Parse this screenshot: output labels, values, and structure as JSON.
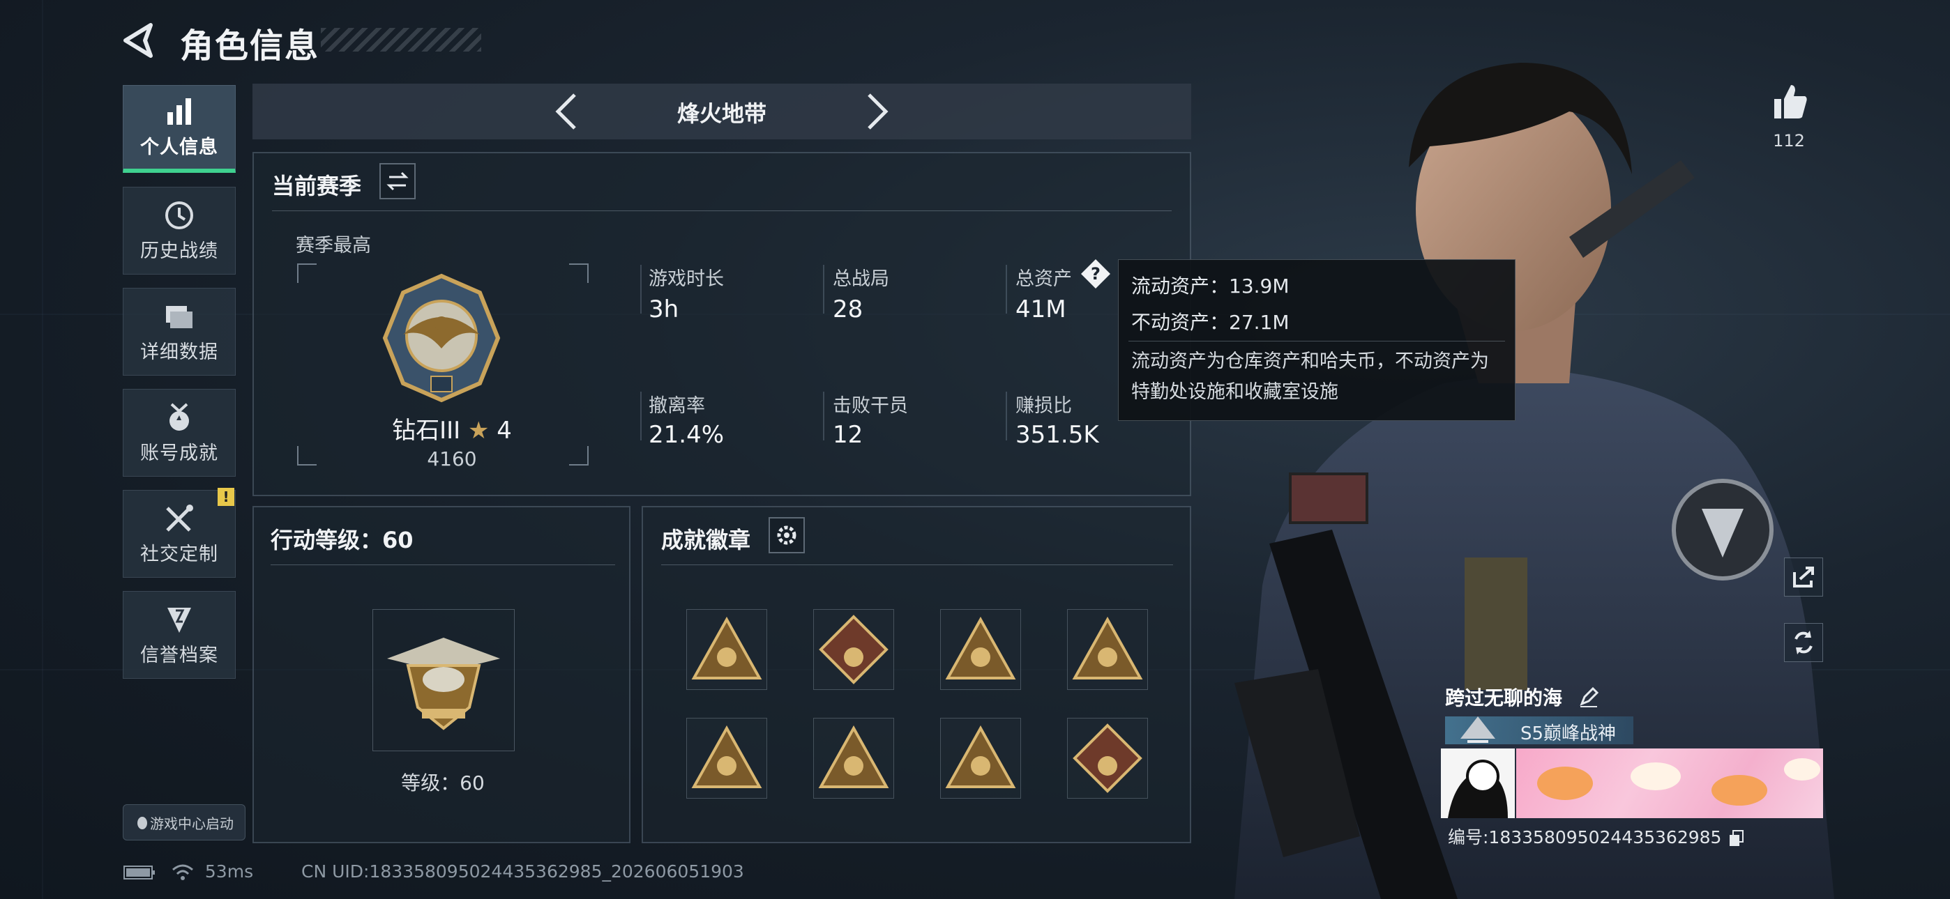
{
  "header": {
    "title": "角色信息"
  },
  "sidebar": {
    "items": [
      {
        "label": "个人信息",
        "icon": "bar-chart-icon"
      },
      {
        "label": "历史战绩",
        "icon": "history-clock-icon"
      },
      {
        "label": "详细数据",
        "icon": "folder-data-icon"
      },
      {
        "label": "账号成就",
        "icon": "achievement-medal-icon"
      },
      {
        "label": "社交定制",
        "icon": "wrench-tools-icon"
      },
      {
        "label": "信誉档案",
        "icon": "credit-shield-icon"
      }
    ],
    "alert_badge": "!",
    "launch_label": "游戏中心启动"
  },
  "mode": {
    "title": "烽火地带"
  },
  "season": {
    "title": "当前赛季",
    "best_label": "赛季最高",
    "rank_name": "钻石III",
    "rank_stars": "4",
    "rank_score": "4160",
    "stats": [
      {
        "label": "游戏时长",
        "value": "3h"
      },
      {
        "label": "总战局",
        "value": "28"
      },
      {
        "label": "总资产",
        "value": "41M"
      },
      {
        "label": "撤离率",
        "value": "21.4%"
      },
      {
        "label": "击败干员",
        "value": "12"
      },
      {
        "label": "赚损比",
        "value": "351.5K"
      }
    ]
  },
  "tooltip": {
    "liquid": "流动资产：13.9M",
    "fixed": "不动资产：27.1M",
    "description": "流动资产为仓库资产和哈夫币，不动资产为特勤处设施和收藏室设施"
  },
  "action_level": {
    "title": "行动等级：60",
    "level_label": "等级：60"
  },
  "achievements": {
    "title": "成就徽章",
    "badges": [
      "hourglass",
      "dragon",
      "bottle",
      "s4",
      "s6",
      "shell",
      "compass",
      "wolf"
    ]
  },
  "profile": {
    "like_count": "112",
    "player_name": "跨过无聊的海",
    "rank_title": "S5巅峰战神",
    "player_id": "编号:1833580950244353629​85"
  },
  "status": {
    "ping": "53ms",
    "uid": "CN UID:183358095024435362985_202606051903"
  },
  "colors": {
    "accent_green": "#3fd18f",
    "gold": "#c9a35a",
    "alert": "#e8c84a"
  }
}
